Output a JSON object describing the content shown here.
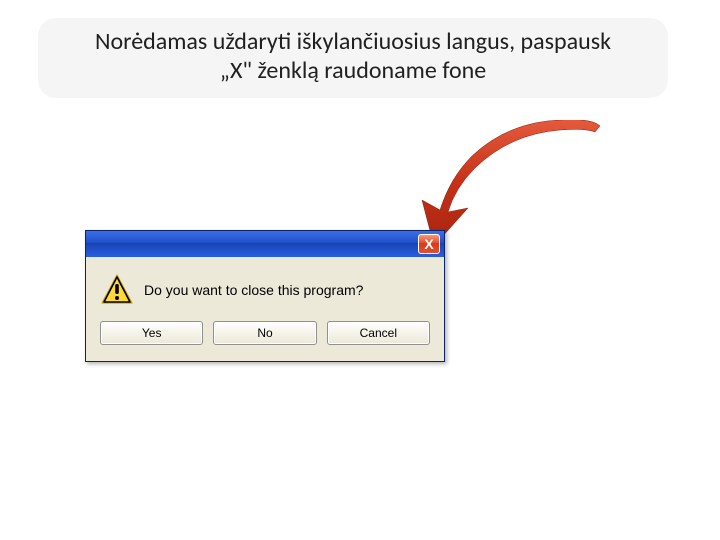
{
  "instruction": {
    "line1": "Norėdamas uždaryti iškylančiuosius langus, paspausk",
    "line2": "„X\" ženklą raudoname fone"
  },
  "dialog": {
    "close_label": "X",
    "message": "Do you want to close this program?",
    "buttons": {
      "yes": "Yes",
      "no": "No",
      "cancel": "Cancel"
    }
  },
  "icons": {
    "warning": "warning-triangle",
    "arrow": "curved-red-arrow"
  },
  "colors": {
    "banner_bg": "#f5f5f5",
    "titlebar_blue": "#1f50c9",
    "close_red": "#e8492a",
    "dialog_bg": "#ece9d8"
  }
}
